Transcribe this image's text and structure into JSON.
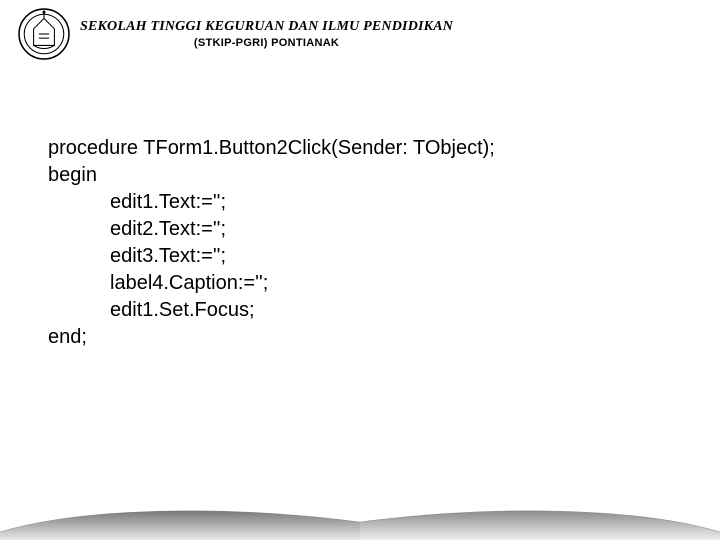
{
  "header": {
    "title": "SEKOLAH TINGGI KEGURUAN DAN ILMU PENDIDIKAN",
    "subtitle": "(STKIP-PGRI) PONTIANAK"
  },
  "code": {
    "l1": "procedure TForm1.Button2Click(Sender: TObject);",
    "l2": "begin",
    "l3": "edit1.Text:='';",
    "l4": "edit2.Text:='';",
    "l5": "edit3.Text:='';",
    "l6": "label4.Caption:='';",
    "l7": "edit1.Set.Focus;",
    "l8": "end;"
  }
}
